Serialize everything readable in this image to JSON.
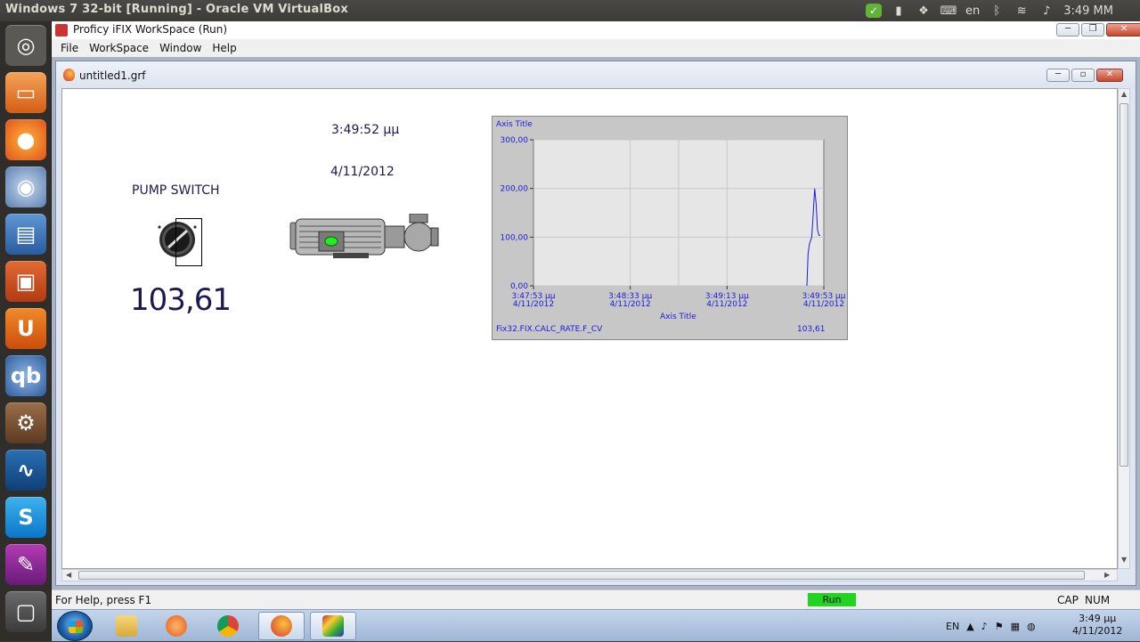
{
  "host": {
    "title": "Windows 7 32-bit [Running] - Oracle VM VirtualBox",
    "tray": {
      "keyboard": "en",
      "clock": "3:49 MM"
    }
  },
  "app": {
    "title": "Proficy iFIX WorkSpace (Run)",
    "menu": [
      "File",
      "WorkSpace",
      "Window",
      "Help"
    ]
  },
  "document": {
    "title": "untitled1.grf",
    "time": "3:49:52 μμ",
    "date": "4/11/2012",
    "pump_label": "PUMP SWITCH",
    "pump_value": "103,61"
  },
  "chart_data": {
    "type": "line",
    "ylabel": "Axis Title",
    "xlabel": "Axis Title",
    "ylim": [
      0,
      300
    ],
    "y_ticks": [
      "300,00",
      "200,00",
      "100,00",
      "0,00"
    ],
    "x_ticks": [
      {
        "time": "3:47:53 μμ",
        "date": "4/11/2012"
      },
      {
        "time": "3:48:33 μμ",
        "date": "4/11/2012"
      },
      {
        "time": "3:49:13 μμ",
        "date": "4/11/2012"
      },
      {
        "time": "3:49:53 μμ",
        "date": "4/11/2012"
      }
    ],
    "grid": true,
    "series": [
      {
        "name": "Fix32.FIX.CALC_RATE.F_CV",
        "current": "103,61",
        "color": "#1a1adc",
        "points": [
          {
            "t": 113.0,
            "y": 0
          },
          {
            "t": 113.5,
            "y": 65
          },
          {
            "t": 114.0,
            "y": 85
          },
          {
            "t": 115.0,
            "y": 100
          },
          {
            "t": 115.6,
            "y": 145
          },
          {
            "t": 116.2,
            "y": 200
          },
          {
            "t": 116.8,
            "y": 170
          },
          {
            "t": 117.4,
            "y": 115
          },
          {
            "t": 118.0,
            "y": 103.61
          },
          {
            "t": 118.5,
            "y": 103.61
          }
        ]
      }
    ]
  },
  "statusbar": {
    "help": "For Help, press F1",
    "mode": "Run",
    "cap": "CAP",
    "num": "NUM"
  },
  "taskbar": {
    "lang": "EN",
    "time": "3:49 μμ",
    "date": "4/11/2012"
  },
  "colors": {
    "run": "#22d322",
    "trend": "#1a1adc",
    "value_text": "#1a1a50"
  }
}
